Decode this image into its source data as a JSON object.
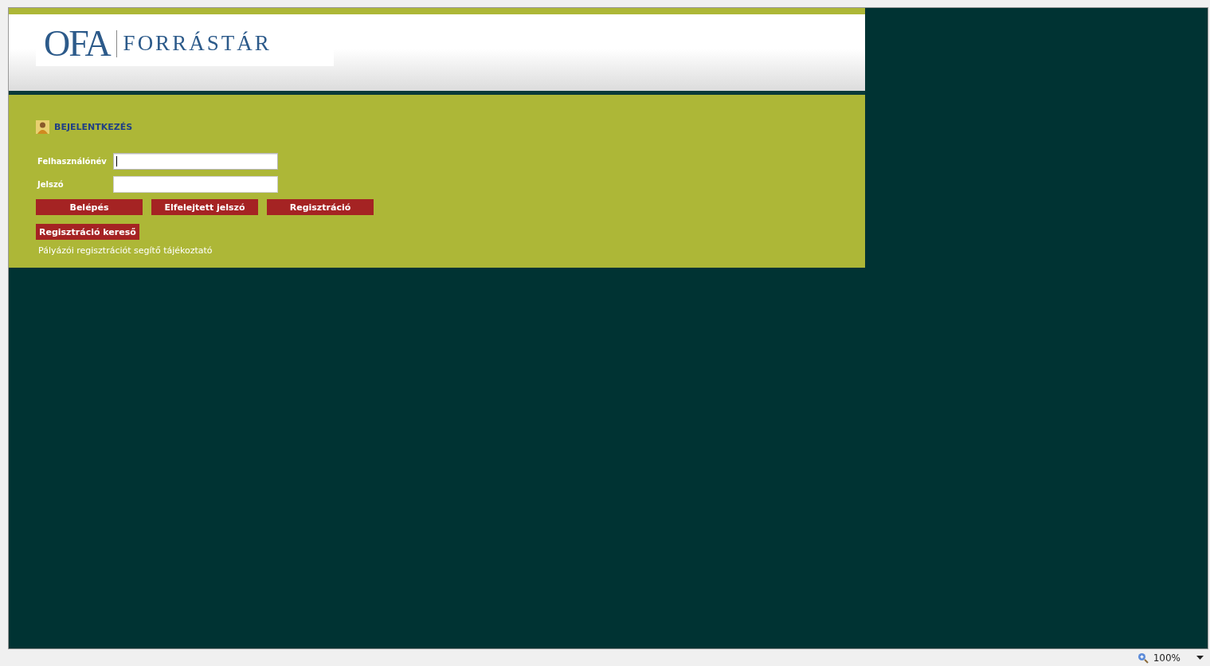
{
  "header": {
    "logo_mark": "OFA",
    "logo_text": "FORRÁSTÁR"
  },
  "login": {
    "title": "BEJELENTKEZÉS",
    "fields": [
      {
        "label": "Felhasználónév",
        "focused": true
      },
      {
        "label": "Jelszó",
        "focused": false
      }
    ],
    "buttons": [
      "Belépés",
      "Elfelejtett jelszó",
      "Regisztráció"
    ],
    "secondary_button": "Regisztráció kereső",
    "help_link": "Pályázói regisztrációt segítő tájékoztató"
  },
  "status_bar": {
    "zoom": "100%"
  }
}
